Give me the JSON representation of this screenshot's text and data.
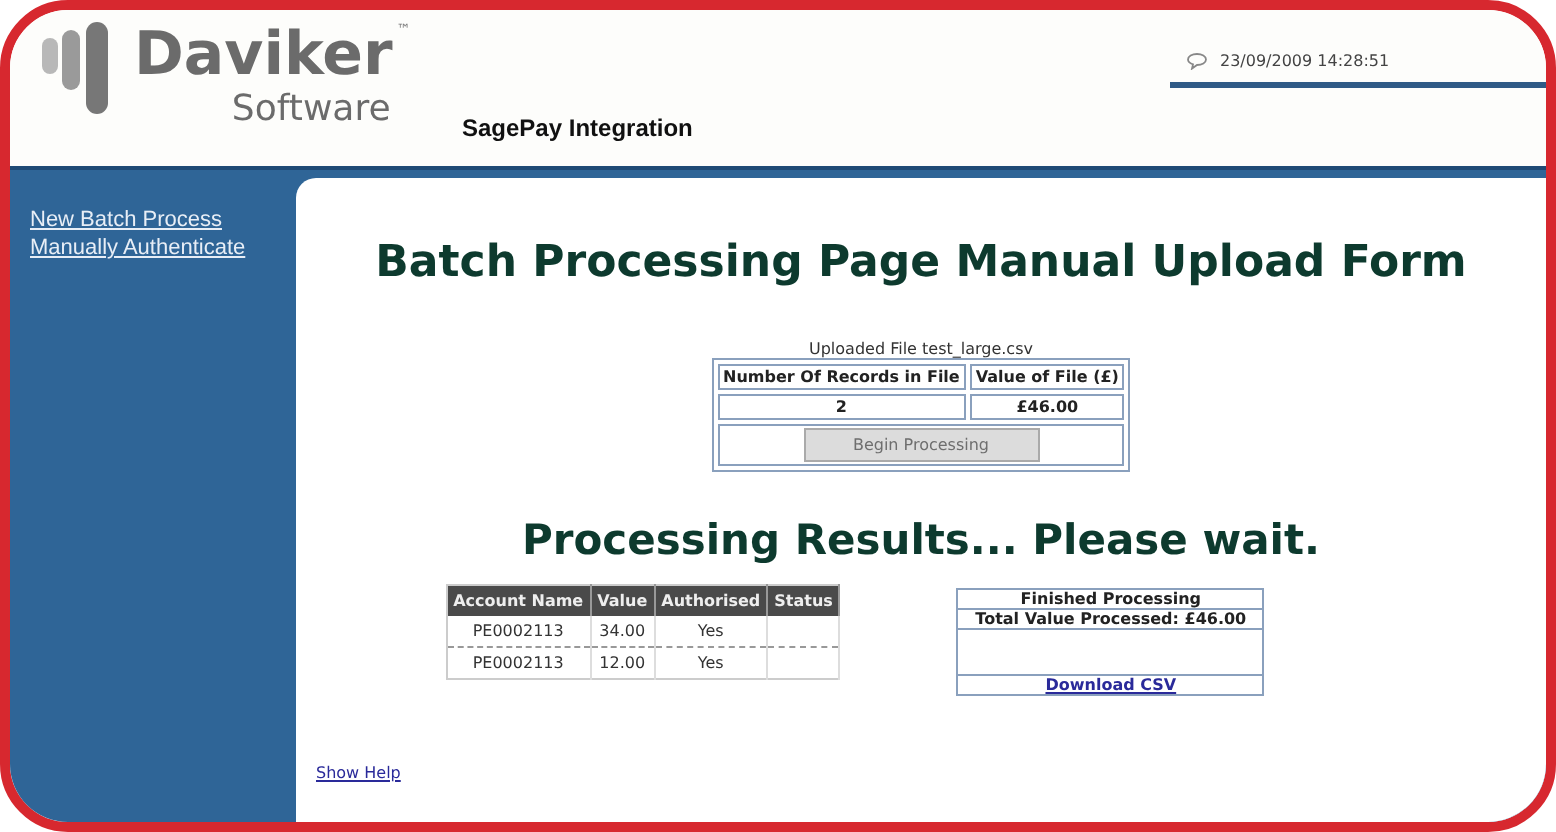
{
  "logo": {
    "name": "Daviker",
    "trademark": "™",
    "tagline": "Software"
  },
  "app_title": "SagePay Integration",
  "datetime": "23/09/2009 14:28:51",
  "sidebar": {
    "links": [
      "New Batch Process",
      "Manually Authenticate"
    ]
  },
  "page_title": "Batch Processing Page Manual Upload Form",
  "upload": {
    "caption": "Uploaded File test_large.csv",
    "columns": [
      "Number Of Records in File",
      "Value of File (£)"
    ],
    "values": [
      "2",
      "£46.00"
    ],
    "button": {
      "label": "Begin Processing",
      "disabled": true
    }
  },
  "results_heading": "Processing Results... Please wait.",
  "results_table": {
    "columns": [
      "Account Name",
      "Value",
      "Authorised",
      "Status"
    ],
    "rows": [
      [
        "PE0002113",
        "34.00",
        "Yes",
        ""
      ],
      [
        "PE0002113",
        "12.00",
        "Yes",
        ""
      ]
    ]
  },
  "summary": {
    "title": "Finished Processing",
    "total": "Total Value Processed: £46.00",
    "link": "Download CSV"
  },
  "help_link": "Show Help"
}
